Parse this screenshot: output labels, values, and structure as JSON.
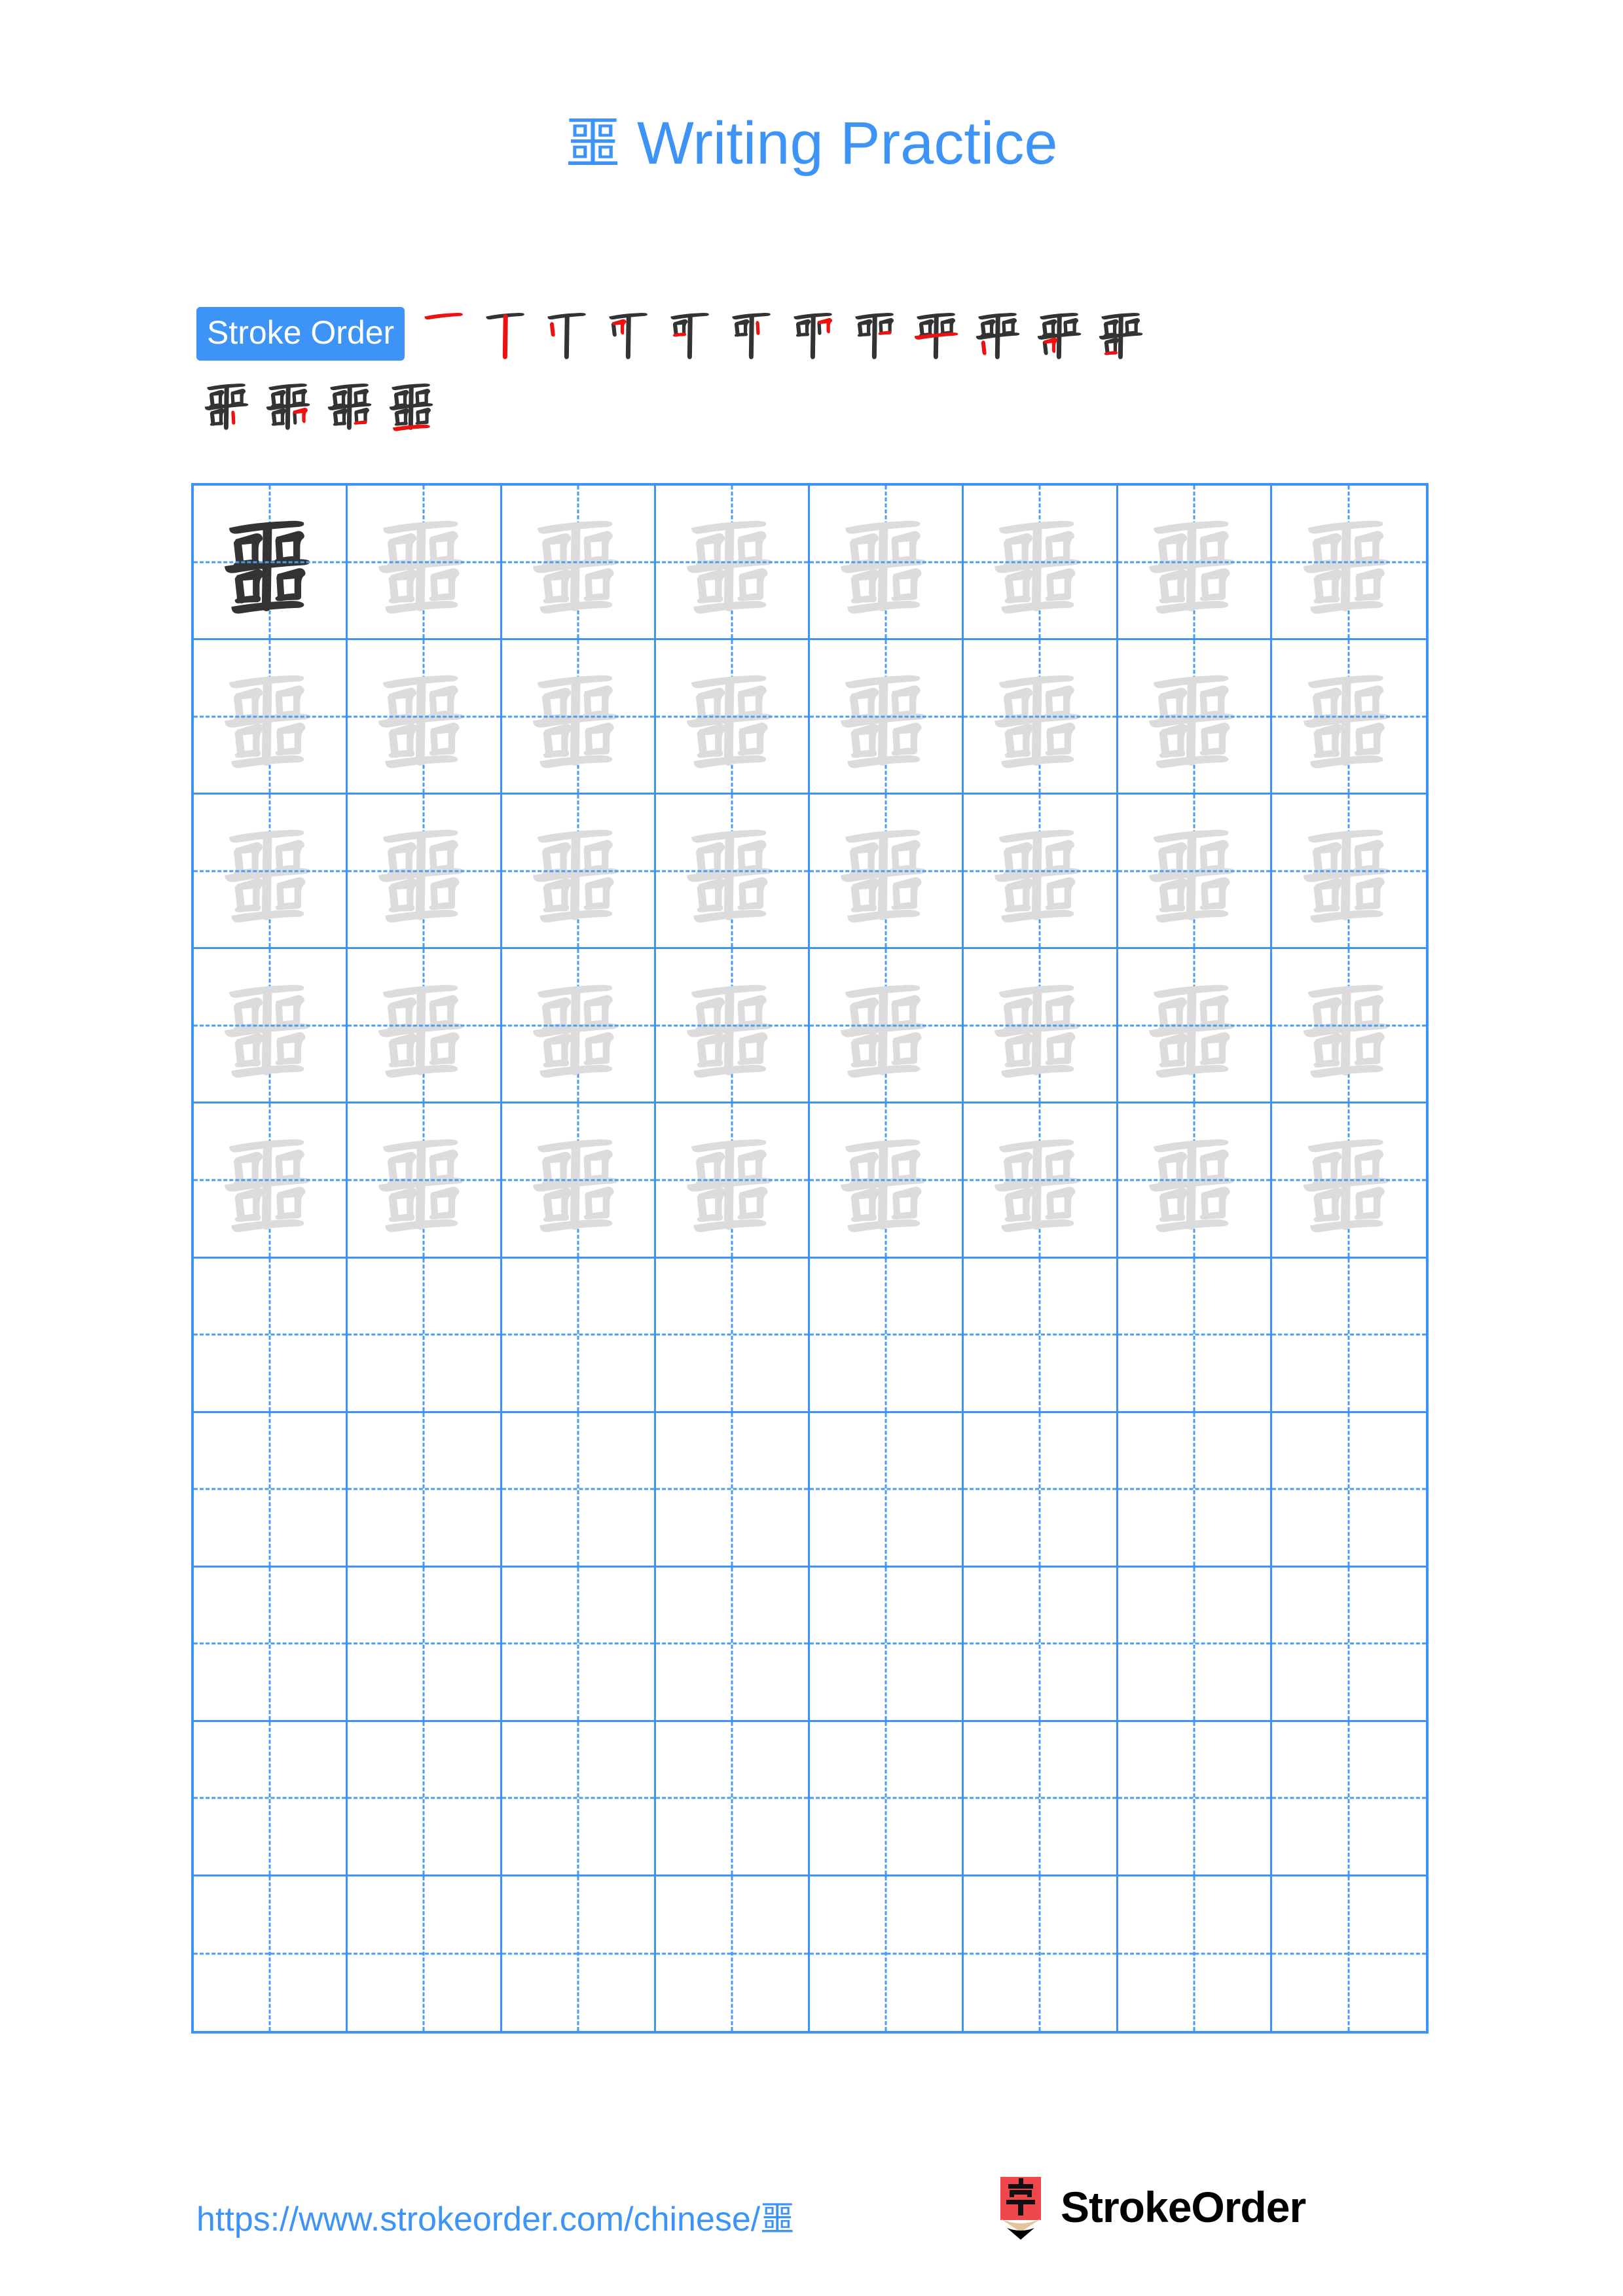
{
  "page": {
    "character": "噩",
    "title_suffix": " Writing Practice",
    "title_full": "噩 Writing Practice",
    "accent_color": "#3d94f6",
    "watermark_color": "#dcdcdc",
    "ink_color": "#333333",
    "highlight_stroke_color": "#ee1111",
    "logo_red": "#f0474c",
    "logo_wood": "#e3c49b"
  },
  "stroke_order": {
    "badge_label": "Stroke Order",
    "total_strokes": 16,
    "steps_row_1_count": 12,
    "steps_row_2_count": 4,
    "steps": [
      {
        "index": 1,
        "name": "heng"
      },
      {
        "index": 2,
        "name": "shu"
      },
      {
        "index": 3,
        "name": "shu"
      },
      {
        "index": 4,
        "name": "heng-zhe"
      },
      {
        "index": 5,
        "name": "heng"
      },
      {
        "index": 6,
        "name": "shu"
      },
      {
        "index": 7,
        "name": "heng-zhe"
      },
      {
        "index": 8,
        "name": "heng"
      },
      {
        "index": 9,
        "name": "heng"
      },
      {
        "index": 10,
        "name": "shu"
      },
      {
        "index": 11,
        "name": "heng-zhe"
      },
      {
        "index": 12,
        "name": "heng"
      },
      {
        "index": 13,
        "name": "shu"
      },
      {
        "index": 14,
        "name": "heng-zhe"
      },
      {
        "index": 15,
        "name": "heng"
      },
      {
        "index": 16,
        "name": "heng"
      }
    ]
  },
  "grid": {
    "columns": 8,
    "rows": 10,
    "filled_rows": 5,
    "empty_rows": 5,
    "solid_first_cell": {
      "row": 1,
      "col": 1
    },
    "guide_style": "dashed-cross"
  },
  "footer": {
    "url_text": "https://www.strokeorder.com/chinese/噩",
    "brand_name": "StrokeOrder",
    "brand_icon": "pencil-zi-icon",
    "brand_icon_char": "字"
  }
}
